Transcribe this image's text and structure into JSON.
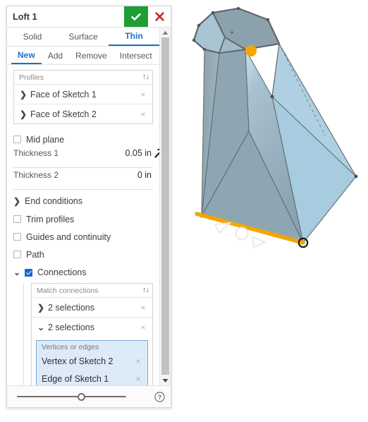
{
  "dialog": {
    "title": "Loft 1",
    "accept_label": "accept",
    "cancel_label": "cancel",
    "primary_tabs": [
      {
        "label": "Solid",
        "active": false
      },
      {
        "label": "Surface",
        "active": false
      },
      {
        "label": "Thin",
        "active": true
      }
    ],
    "secondary_tabs": [
      {
        "label": "New",
        "active": true
      },
      {
        "label": "Add",
        "active": false
      },
      {
        "label": "Remove",
        "active": false
      },
      {
        "label": "Intersect",
        "active": false
      }
    ],
    "profiles": {
      "header": "Profiles",
      "sort_glyph": "↑↓",
      "rows": [
        {
          "chevron": "❯",
          "label": "Face of Sketch 1",
          "remove": "×"
        },
        {
          "chevron": "❯",
          "label": "Face of Sketch 2",
          "remove": "×"
        }
      ]
    },
    "mid_plane": {
      "label": "Mid plane",
      "checked": false
    },
    "thickness_1": {
      "label": "Thickness 1",
      "value": "0.05 in"
    },
    "thickness_2": {
      "label": "Thickness 2",
      "value": "0 in"
    },
    "end_conditions": {
      "label": "End conditions",
      "chevron": "❯",
      "expanded": false
    },
    "trim_profiles": {
      "label": "Trim profiles",
      "checked": false
    },
    "guides_continuity": {
      "label": "Guides and continuity",
      "checked": false
    },
    "path": {
      "label": "Path",
      "checked": false
    },
    "connections": {
      "label": "Connections",
      "checked": true,
      "chevron": "⌄",
      "expanded": true
    },
    "match_connections": {
      "header": "Match connections",
      "sort_glyph": "↑↓",
      "rows": [
        {
          "chevron": "❯",
          "label": "2 selections",
          "remove": "×",
          "expanded": false
        },
        {
          "chevron": "⌄",
          "label": "2 selections",
          "remove": "×",
          "expanded": true
        }
      ],
      "sub_selection": {
        "header": "Vertices or edges",
        "items": [
          {
            "label": "Vertex of Sketch 2",
            "remove": "×"
          },
          {
            "label": "Edge of Sketch 1",
            "remove": "×"
          }
        ]
      }
    },
    "footer": {
      "slider_name": "opacity-slider",
      "help_label": "?"
    },
    "scrollbar": {
      "up_glyph": "▲",
      "down_glyph": "▼"
    }
  },
  "viewport": {
    "model_name": "loft-solid-preview",
    "colors": {
      "face_light": "#a8cadd",
      "face_mid": "#8fa8b4",
      "face_dark": "#7d919c",
      "edge": "#5a6168",
      "highlight_orange": "#f5a500",
      "vertex_marker": "#1a1a1a",
      "background": "#ffffff"
    },
    "markers": {
      "selected_vertex": "orange-dot",
      "selected_edge": "orange-edge",
      "direction_handles": "triangle-circle-triangle"
    }
  }
}
